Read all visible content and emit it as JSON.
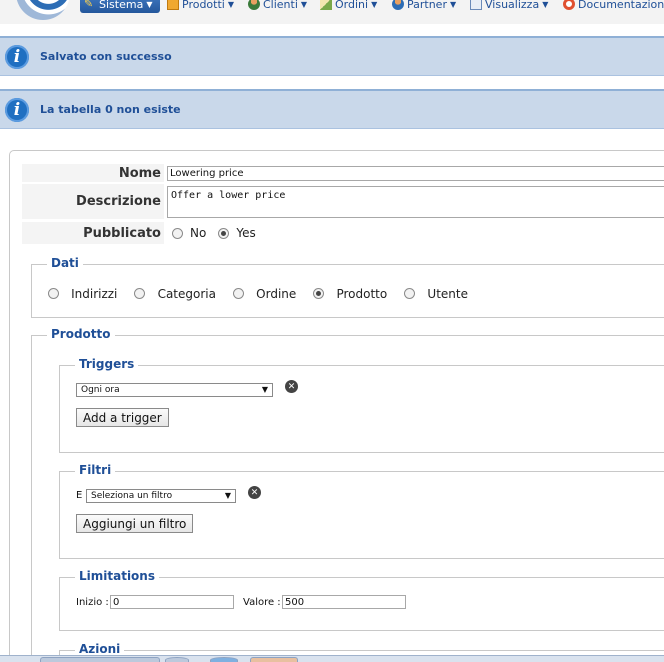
{
  "menubar": {
    "items": [
      {
        "label": "Sistema",
        "icon": "wrench-icon"
      },
      {
        "label": "Prodotti",
        "icon": "box-icon"
      },
      {
        "label": "Clienti",
        "icon": "user-icon"
      },
      {
        "label": "Ordini",
        "icon": "orders-icon"
      },
      {
        "label": "Partner",
        "icon": "partner-icon"
      },
      {
        "label": "Visualizza",
        "icon": "display-icon"
      },
      {
        "label": "Documentazione",
        "icon": "lifebuoy-icon"
      }
    ]
  },
  "messages": [
    {
      "text": "Salvato con successo",
      "icon": "info-icon"
    },
    {
      "text": "La tabella 0 non esiste",
      "icon": "info-icon"
    }
  ],
  "form": {
    "name": {
      "label": "Nome",
      "value": "Lowering price"
    },
    "description": {
      "label": "Descrizione",
      "value": "Offer a lower price"
    },
    "published": {
      "label": "Pubblicato",
      "options": [
        "No",
        "Yes"
      ],
      "selected": "Yes"
    }
  },
  "dati": {
    "title": "Dati",
    "options": [
      "Indirizzi",
      "Categoria",
      "Ordine",
      "Prodotto",
      "Utente"
    ],
    "selected": "Prodotto"
  },
  "prodotto": {
    "title": "Prodotto",
    "triggers": {
      "title": "Triggers",
      "select_value": "Ogni ora",
      "add_button": "Add a trigger"
    },
    "filters": {
      "title": "Filtri",
      "prefix": "E",
      "select_value": "Seleziona un filtro",
      "add_button": "Aggiungi un filtro"
    },
    "limitations": {
      "title": "Limitations",
      "start_label": "Inizio :",
      "start_value": "0",
      "value_label": "Valore :",
      "value_value": "500"
    },
    "actions": {
      "title": "Azioni"
    }
  },
  "colors": {
    "accent": "#1f4f97",
    "banner": "#c9d8ea",
    "active_menu": "#2d65ad"
  }
}
